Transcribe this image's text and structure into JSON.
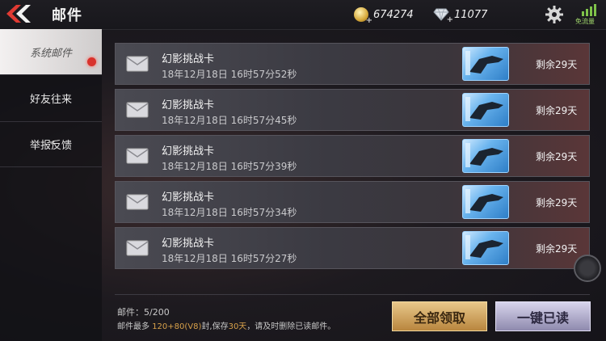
{
  "header": {
    "title": "邮件",
    "gold": "674274",
    "diamonds": "11077",
    "gold_plus": "+",
    "diamond_plus": "+",
    "traffic_label": "免流量"
  },
  "sidebar": {
    "items": [
      {
        "label": "系统邮件"
      },
      {
        "label": "好友往来"
      },
      {
        "label": "举报反馈"
      }
    ]
  },
  "mails": [
    {
      "title": "幻影挑战卡",
      "time": "18年12月18日 16时57分52秒",
      "remaining": "剩余29天"
    },
    {
      "title": "幻影挑战卡",
      "time": "18年12月18日 16时57分45秒",
      "remaining": "剩余29天"
    },
    {
      "title": "幻影挑战卡",
      "time": "18年12月18日 16时57分39秒",
      "remaining": "剩余29天"
    },
    {
      "title": "幻影挑战卡",
      "time": "18年12月18日 16时57分34秒",
      "remaining": "剩余29天"
    },
    {
      "title": "幻影挑战卡",
      "time": "18年12月18日 16时57分27秒",
      "remaining": "剩余29天"
    }
  ],
  "footer": {
    "count_label": "邮件：",
    "count_value": "5/200",
    "note_prefix": "邮件最多 ",
    "note_cap": "120+80(V8)",
    "note_mid": "封,保存",
    "note_days": "30天",
    "note_suffix": "，请及时删除已读邮件。",
    "claim_all": "全部领取",
    "read_all": "一键已读"
  },
  "colors": {
    "accent_red": "#d8322c",
    "highlight": "#d8a14a",
    "gold_button": "#c99a4f",
    "lilac_button": "#a9a4c8"
  }
}
